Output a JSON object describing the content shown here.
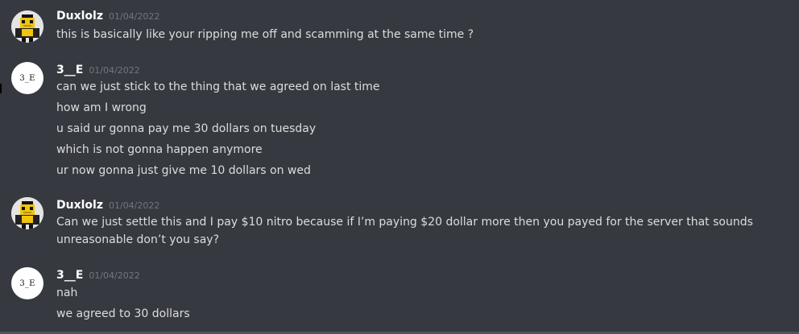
{
  "messages": [
    {
      "username": "Duxlolz",
      "timestamp": "01/04/2022",
      "avatar_icon": "pixel-character-icon",
      "lines": [
        "this is basically like your ripping me off and scamming at the same time ?"
      ]
    },
    {
      "username": "3__E",
      "timestamp": "01/04/2022",
      "avatar_text": "3_E",
      "lines": [
        "can we just stick to the thing that we agreed on last time",
        "how am I wrong",
        "u said ur gonna pay me 30 dollars on tuesday",
        "which is not gonna happen anymore",
        "ur now gonna just give me 10 dollars on wed"
      ]
    },
    {
      "username": "Duxlolz",
      "timestamp": "01/04/2022",
      "avatar_icon": "pixel-character-icon",
      "lines": [
        "Can we just settle this and I pay $10 nitro because if I’m paying $20 dollar more then you payed for the server that sounds unreasonable don’t you say?"
      ]
    },
    {
      "username": "3__E",
      "timestamp": "01/04/2022",
      "avatar_text": "3_E",
      "lines": [
        "nah",
        "we agreed to 30 dollars"
      ]
    }
  ],
  "colors": {
    "background": "#36393f",
    "username": "#ffffff",
    "timestamp": "#72767d",
    "message_text": "#dcddde"
  }
}
